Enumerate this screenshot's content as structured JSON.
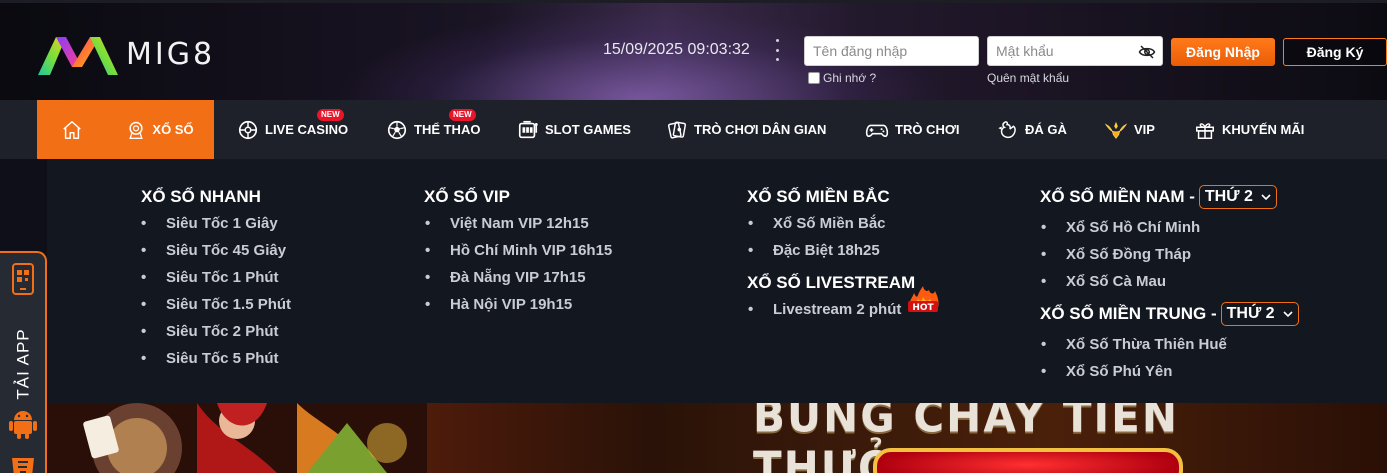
{
  "header": {
    "logo_text": "MIG8",
    "datetime": "15/09/2025 09:03:32",
    "username_placeholder": "Tên đăng nhập",
    "password_placeholder": "Mật khẩu",
    "remember_label": "Ghi nhớ ?",
    "forgot_label": "Quên mật khẩu",
    "login_label": "Đăng Nhập",
    "register_label": "Đăng Ký",
    "accent_color": "#f26f16"
  },
  "nav": {
    "items": [
      {
        "label": "XỔ SỐ",
        "icon": "lottery-icon",
        "active": true
      },
      {
        "label": "LIVE CASINO",
        "icon": "roulette-icon",
        "badge": "NEW"
      },
      {
        "label": "THỂ THAO",
        "icon": "ball-icon",
        "badge": "NEW"
      },
      {
        "label": "SLOT GAMES",
        "icon": "slot-icon"
      },
      {
        "label": "TRÒ CHƠI DÂN GIAN",
        "icon": "cards-icon"
      },
      {
        "label": "TRÒ CHƠI",
        "icon": "gamepad-icon"
      },
      {
        "label": "ĐÁ GÀ",
        "icon": "rooster-icon"
      },
      {
        "label": "VIP",
        "icon": "vip-icon"
      },
      {
        "label": "KHUYẾN MÃI",
        "icon": "gift-icon"
      }
    ]
  },
  "mega": {
    "col1": {
      "title": "XỔ SỐ NHANH",
      "items": [
        "Siêu Tốc 1 Giây",
        "Siêu Tốc 45 Giây",
        "Siêu Tốc 1 Phút",
        "Siêu Tốc 1.5 Phút",
        "Siêu Tốc 2 Phút",
        "Siêu Tốc 5 Phút"
      ]
    },
    "col2": {
      "title": "XỔ SỐ VIP",
      "items": [
        "Việt Nam VIP 12h15",
        "Hồ Chí Minh VIP 16h15",
        "Đà Nẵng VIP 17h15",
        "Hà Nội VIP 19h15"
      ]
    },
    "col3": {
      "title": "XỔ SỐ MIỀN BẮC",
      "items": [
        "Xổ Số Miền Bắc",
        "Đặc Biệt 18h25"
      ],
      "title2": "XỔ SỐ LIVESTREAM",
      "items2": [
        "Livestream 2 phút"
      ],
      "hot_badge": "HOT"
    },
    "col4": {
      "title": "XỔ SỐ MIỀN NAM -",
      "day": "THỨ 2",
      "items": [
        "Xổ Số Hồ Chí Minh",
        "Xổ Số Đồng Tháp",
        "Xổ Số Cà Mau"
      ],
      "title2": "XỔ SỐ MIỀN TRUNG -",
      "day2": "THỨ 2",
      "items2": [
        "Xổ Số Thừa Thiên Huế",
        "Xổ Số Phú Yên"
      ]
    }
  },
  "banner": {
    "title": "BÙNG CHÁY TIỀN THƯỞNG"
  },
  "app_tab": {
    "label": "TẢI APP"
  }
}
